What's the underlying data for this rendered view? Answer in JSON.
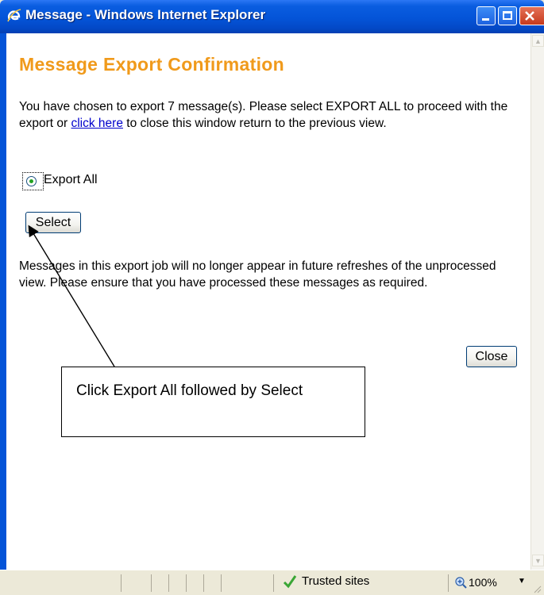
{
  "window": {
    "title": "Message - Windows Internet Explorer",
    "icon": "ie-logo-icon"
  },
  "page": {
    "heading": "Message Export Confirmation",
    "intro_before_link": "You have chosen to export 7 message(s). Please select EXPORT ALL to proceed with the export or ",
    "intro_link": "click here",
    "intro_after_link": " to close this window return to the previous view.",
    "radio_label": "Export All",
    "radio_checked": true,
    "select_button": "Select",
    "notice": "Messages in this export job will no longer appear in future refreshes of the unprocessed view. Please ensure that you have processed these messages as required.",
    "close_button": "Close"
  },
  "callout": {
    "text": "Click Export All followed by Select"
  },
  "statusbar": {
    "zone": "Trusted sites",
    "zoom": "100%"
  },
  "colors": {
    "heading": "#f09a1b",
    "titlebar": "#0454d8",
    "link": "#0000cc"
  }
}
